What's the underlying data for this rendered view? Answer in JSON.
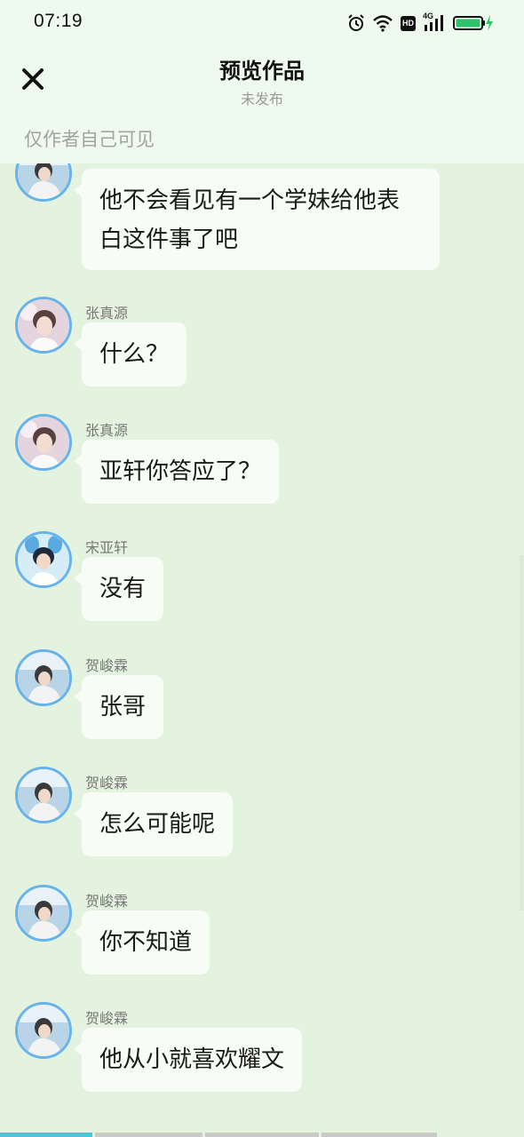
{
  "status_bar": {
    "time": "07:19",
    "icons": [
      "alarm-icon",
      "wifi-icon",
      "hd-badge",
      "signal-4g-icon",
      "battery-charging-icon"
    ],
    "hd_text": "HD",
    "network_label": "4G",
    "battery_color": "#2ec36b"
  },
  "header": {
    "close_icon": "close-icon",
    "title": "预览作品",
    "subtitle": "未发布",
    "visibility_note": "仅作者自己可见"
  },
  "messages": [
    {
      "sender": "",
      "avatar": "avatar-hejunlin",
      "text": "他不会看见有一个学妹给他表白这件事了吧"
    },
    {
      "sender": "张真源",
      "avatar": "avatar-zhangzhenyuan",
      "text": "什么？"
    },
    {
      "sender": "张真源",
      "avatar": "avatar-zhangzhenyuan",
      "text": "亚轩你答应了？"
    },
    {
      "sender": "宋亚轩",
      "avatar": "avatar-songyaxuan",
      "text": "没有"
    },
    {
      "sender": "贺峻霖",
      "avatar": "avatar-hejunlin",
      "text": "张哥"
    },
    {
      "sender": "贺峻霖",
      "avatar": "avatar-hejunlin",
      "text": "怎么可能呢"
    },
    {
      "sender": "贺峻霖",
      "avatar": "avatar-hejunlin",
      "text": "你不知道"
    },
    {
      "sender": "贺峻霖",
      "avatar": "avatar-hejunlin",
      "text": "他从小就喜欢耀文"
    }
  ],
  "progress": {
    "segments": 4,
    "active_index": 0
  },
  "colors": {
    "background": "#e4f3df",
    "header_bg": "#eefaed",
    "bubble_bg": "#f8fcf6",
    "avatar_ring": "#67b3ea",
    "progress_active": "#3fc9d4"
  }
}
